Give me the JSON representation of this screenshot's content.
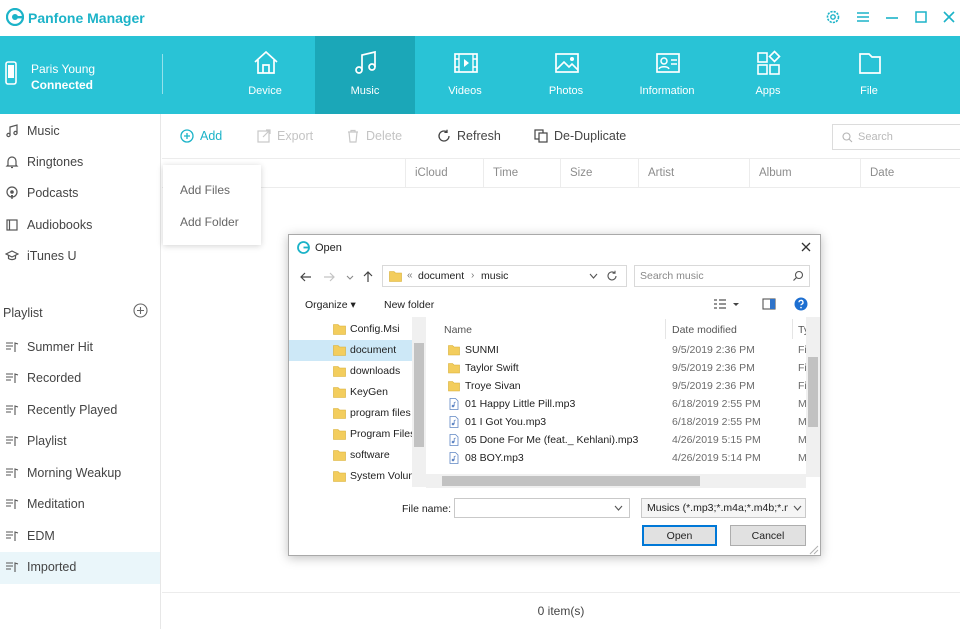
{
  "app": {
    "title": "Panfone Manager",
    "accent_color": "#29c3d6",
    "device_name": "Paris Young",
    "device_status": "Connected"
  },
  "nav": {
    "tabs": [
      {
        "label": "Device",
        "icon": "home-icon"
      },
      {
        "label": "Music",
        "icon": "music-note-icon",
        "active": true
      },
      {
        "label": "Videos",
        "icon": "film-icon"
      },
      {
        "label": "Photos",
        "icon": "image-icon"
      },
      {
        "label": "Information",
        "icon": "contact-card-icon"
      },
      {
        "label": "Apps",
        "icon": "apps-grid-icon"
      },
      {
        "label": "File",
        "icon": "folder-icon"
      }
    ]
  },
  "sidebar": {
    "library": [
      {
        "label": "Music",
        "icon": "music-note-icon"
      },
      {
        "label": "Ringtones",
        "icon": "bell-icon"
      },
      {
        "label": "Podcasts",
        "icon": "podcast-icon"
      },
      {
        "label": "Audiobooks",
        "icon": "book-icon"
      },
      {
        "label": "iTunes U",
        "icon": "graduation-cap-icon"
      }
    ],
    "playlist_heading": "Playlist",
    "playlists": [
      {
        "label": "Summer Hit"
      },
      {
        "label": "Recorded"
      },
      {
        "label": "Recently Played"
      },
      {
        "label": "Playlist"
      },
      {
        "label": "Morning Weakup"
      },
      {
        "label": "Meditation"
      },
      {
        "label": "EDM"
      },
      {
        "label": "Imported",
        "selected": true
      }
    ]
  },
  "toolbar": {
    "add": "Add",
    "export": "Export",
    "delete": "Delete",
    "refresh": "Refresh",
    "deduplicate": "De-Duplicate",
    "search_placeholder": "Search"
  },
  "add_menu": {
    "items": [
      "Add Files",
      "Add Folder"
    ]
  },
  "columns": [
    "iCloud",
    "Time",
    "Size",
    "Artist",
    "Album",
    "Date"
  ],
  "footer": {
    "item_count": "0 item(s)"
  },
  "dialog": {
    "title": "Open",
    "path": [
      "document",
      "music"
    ],
    "path_prefix": "«",
    "search_placeholder": "Search music",
    "organize": "Organize ▾",
    "new_folder": "New folder",
    "nav_items": [
      {
        "label": "Config.Msi"
      },
      {
        "label": "document",
        "selected": true
      },
      {
        "label": "downloads"
      },
      {
        "label": "KeyGen"
      },
      {
        "label": "program files"
      },
      {
        "label": "Program Files"
      },
      {
        "label": "software"
      },
      {
        "label": "System Volum"
      }
    ],
    "headers": {
      "name": "Name",
      "date": "Date modified",
      "type": "Ty"
    },
    "files": [
      {
        "name": "SUNMI",
        "date": "9/5/2019 2:36 PM",
        "type": "Fi",
        "kind": "folder"
      },
      {
        "name": "Taylor Swift",
        "date": "9/5/2019 2:36 PM",
        "type": "Fi",
        "kind": "folder"
      },
      {
        "name": "Troye Sivan",
        "date": "9/5/2019 2:36 PM",
        "type": "Fi",
        "kind": "folder"
      },
      {
        "name": "01 Happy Little Pill.mp3",
        "date": "6/18/2019 2:55 PM",
        "type": "M",
        "kind": "audio"
      },
      {
        "name": "01 I Got You.mp3",
        "date": "6/18/2019 2:55 PM",
        "type": "M",
        "kind": "audio"
      },
      {
        "name": "05 Done For Me (feat._ Kehlani).mp3",
        "date": "4/26/2019 5:15 PM",
        "type": "M",
        "kind": "audio"
      },
      {
        "name": "08 BOY.mp3",
        "date": "4/26/2019 5:14 PM",
        "type": "M",
        "kind": "audio"
      }
    ],
    "file_name_label": "File name:",
    "file_name_value": "",
    "file_type": "Musics (*.mp3;*.m4a;*.m4b;*.m",
    "open_button": "Open",
    "cancel_button": "Cancel"
  }
}
